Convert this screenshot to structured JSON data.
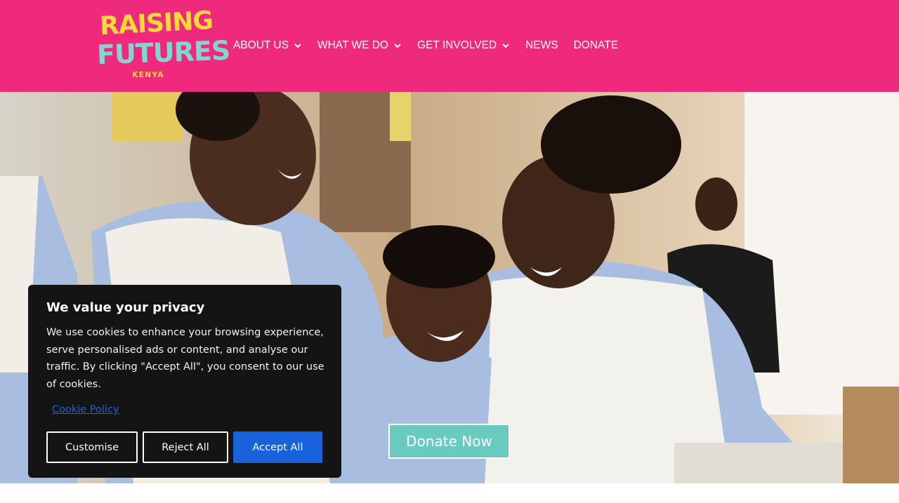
{
  "colors": {
    "header_bg": "#ef2a7d",
    "logo_yellow": "#f7d93b",
    "logo_teal": "#7fd7cf",
    "donate_teal": "#69cbc0",
    "cookie_bg": "#141414",
    "accent_blue": "#1863dc"
  },
  "logo": {
    "line1": "RAISING",
    "line2": "FUTURES",
    "line3": "KENYA"
  },
  "nav": {
    "items": [
      {
        "label": "ABOUT US",
        "has_dropdown": true,
        "icon": "chevron-down-icon"
      },
      {
        "label": "WHAT WE DO",
        "has_dropdown": true,
        "icon": "chevron-down-icon"
      },
      {
        "label": "GET INVOLVED",
        "has_dropdown": true,
        "icon": "chevron-down-icon"
      },
      {
        "label": "NEWS",
        "has_dropdown": false
      },
      {
        "label": "DONATE",
        "has_dropdown": false
      }
    ]
  },
  "hero": {
    "cta_label": "Donate Now"
  },
  "cookie": {
    "title": "We value your privacy",
    "body": "We use cookies to enhance your browsing experience, serve personalised ads or content, and analyse our traffic. By clicking \"Accept All\", you consent to our use of cookies.",
    "policy_link": "Cookie Policy",
    "customise_label": "Customise",
    "reject_label": "Reject All",
    "accept_label": "Accept All"
  }
}
